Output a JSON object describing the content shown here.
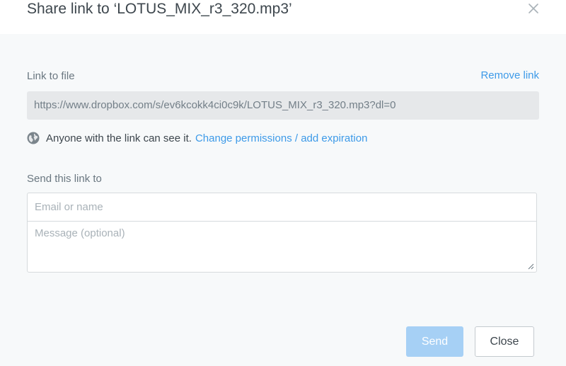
{
  "dialog": {
    "title": "Share link to ‘LOTUS_MIX_r3_320.mp3’",
    "close_icon": "close-x-icon"
  },
  "link_section": {
    "label": "Link to file",
    "remove_link": "Remove link",
    "url": "https://www.dropbox.com/s/ev6kcokk4ci0c9k/LOTUS_MIX_r3_320.mp3?dl=0"
  },
  "permissions": {
    "icon": "globe-icon",
    "text": "Anyone with the link can see it.",
    "change_link": "Change permissions / add expiration"
  },
  "send_section": {
    "label": "Send this link to",
    "email_placeholder": "Email or name",
    "message_placeholder": "Message (optional)"
  },
  "buttons": {
    "send": "Send",
    "close": "Close"
  },
  "colors": {
    "accent": "#3d9ae8",
    "send_disabled": "#a6d0f5"
  }
}
